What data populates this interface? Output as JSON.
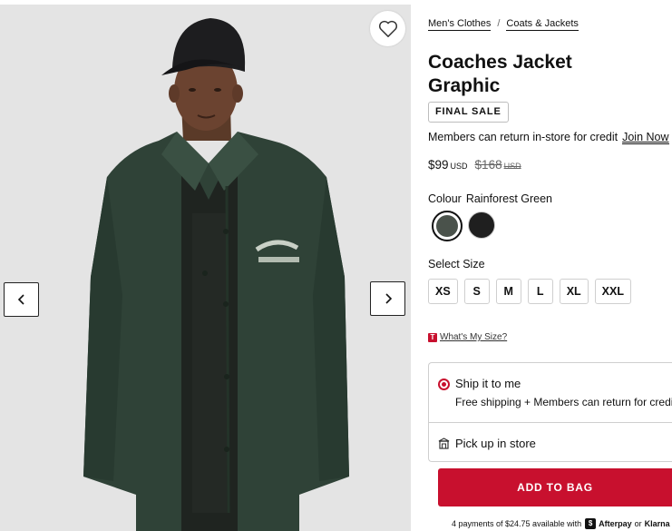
{
  "breadcrumb": {
    "items": [
      "Men's Clothes",
      "Coats & Jackets"
    ],
    "separator": "/"
  },
  "product": {
    "title_line1": "Coaches Jacket",
    "title_line2": "Graphic",
    "badge": "FINAL SALE",
    "returns_text": "Members can return in-store for credit",
    "join_label": "Join Now",
    "price": "$99",
    "price_currency": "USD",
    "old_price": "$168",
    "old_currency": "USD"
  },
  "colour": {
    "label": "Colour",
    "selected": "Rainforest Green",
    "swatches": [
      {
        "name": "Rainforest Green",
        "color": "#4a524b",
        "selected": true
      },
      {
        "name": "Black",
        "color": "#1f1f1f",
        "selected": false
      }
    ]
  },
  "size": {
    "label": "Select Size",
    "options": [
      "XS",
      "S",
      "M",
      "L",
      "XL",
      "XXL"
    ],
    "guide_icon": "T",
    "guide_label": "What's My Size?"
  },
  "delivery": {
    "ship_title": "Ship it to me",
    "ship_sub": "Free shipping + Members can return for credit",
    "pickup_title": "Pick up in store"
  },
  "cart": {
    "add_label": "ADD TO BAG"
  },
  "payments": {
    "text": "4 payments of $24.75 available with",
    "afterpay": "Afterpay",
    "or": "or",
    "klarna": "Klarna"
  },
  "gallery": {
    "prev_icon": "chevron-left-icon",
    "next_icon": "chevron-right-icon",
    "wishlist_icon": "heart-icon"
  },
  "colors": {
    "accent": "#c8102e",
    "image_bg": "#e4e4e4",
    "jacket": "#2f4237"
  }
}
